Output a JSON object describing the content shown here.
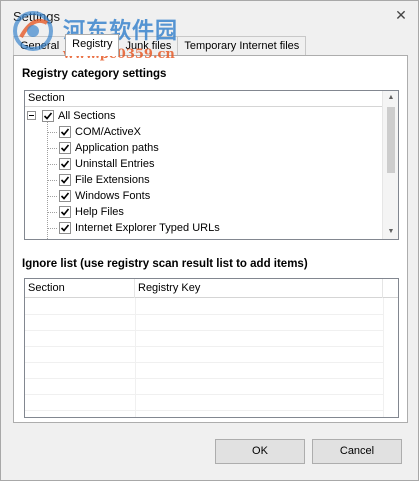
{
  "window": {
    "title": "Settings",
    "close_glyph": "✕"
  },
  "watermark": {
    "text": "河东软件园",
    "url": "www.pc0359.cn"
  },
  "tabs": [
    {
      "label": "General",
      "active": false
    },
    {
      "label": "Registry",
      "active": true
    },
    {
      "label": "Junk files",
      "active": false
    },
    {
      "label": "Temporary Internet files",
      "active": false
    }
  ],
  "registry": {
    "category_heading": "Registry category settings",
    "tree_header": "Section",
    "root": {
      "label": "All Sections",
      "checked": true,
      "expanded": true
    },
    "items": [
      {
        "label": "COM/ActiveX",
        "checked": true
      },
      {
        "label": "Application paths",
        "checked": true
      },
      {
        "label": "Uninstall Entries",
        "checked": true
      },
      {
        "label": "File Extensions",
        "checked": true
      },
      {
        "label": "Windows Fonts",
        "checked": true
      },
      {
        "label": "Help Files",
        "checked": true
      },
      {
        "label": "Internet Explorer Typed URLs",
        "checked": true
      }
    ],
    "ignore_heading": "Ignore list (use registry scan result list to add items)",
    "ignore_columns": [
      "Section",
      "Registry Key"
    ],
    "ignore_rows": []
  },
  "buttons": {
    "ok": "OK",
    "cancel": "Cancel"
  },
  "colors": {
    "accent": "#0078d7",
    "border": "#828790",
    "button_bg": "#e1e1e1"
  }
}
